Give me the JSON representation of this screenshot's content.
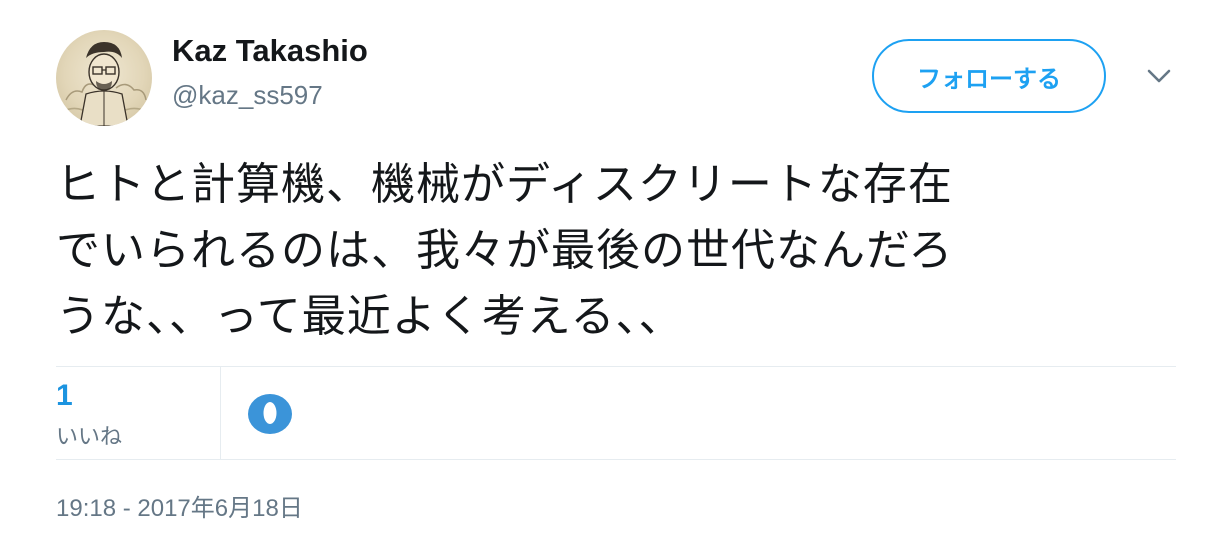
{
  "user": {
    "display_name": "Kaz Takashio",
    "handle": "@kaz_ss597"
  },
  "actions": {
    "follow_label": "フォローする"
  },
  "tweet": {
    "lines": [
      "ヒトと計算機、機械がディスクリートな存在",
      "でいられるのは、我々が最後の世代なんだろ",
      "うな、、って最近よく考える、、"
    ]
  },
  "stats": {
    "likes_count": "1",
    "likes_label": "いいね"
  },
  "timestamp": "19:18 - 2017年6月18日",
  "colors": {
    "accent": "#1da1f2",
    "likes_count": "#1c94e0",
    "secondary_text": "#657786",
    "divider": "#e6ecf0"
  },
  "icons": {
    "caret": "chevron-down-icon",
    "liker": "liker-avatar-icon"
  }
}
